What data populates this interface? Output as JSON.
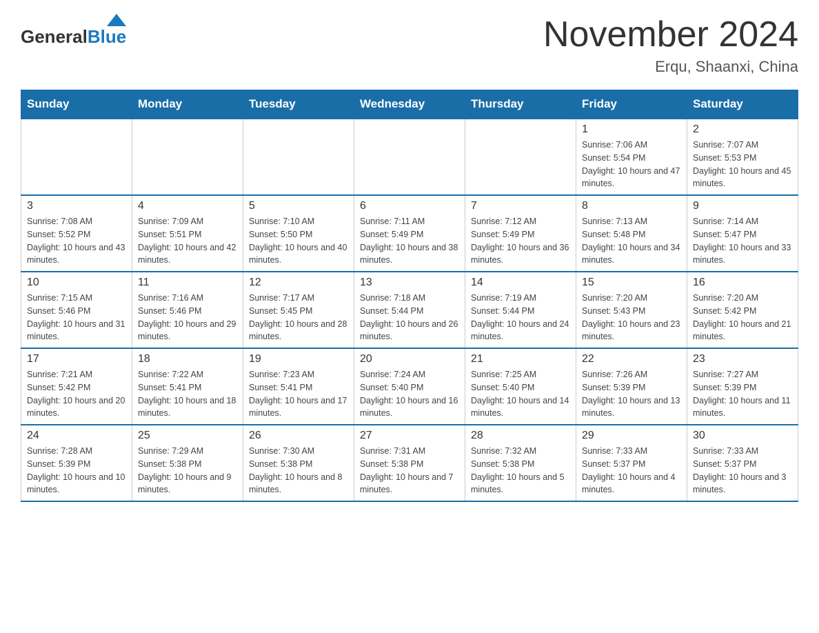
{
  "header": {
    "logo_general": "General",
    "logo_blue": "Blue",
    "month_title": "November 2024",
    "location": "Erqu, Shaanxi, China"
  },
  "weekdays": [
    "Sunday",
    "Monday",
    "Tuesday",
    "Wednesday",
    "Thursday",
    "Friday",
    "Saturday"
  ],
  "weeks": [
    [
      {
        "day": "",
        "sunrise": "",
        "sunset": "",
        "daylight": ""
      },
      {
        "day": "",
        "sunrise": "",
        "sunset": "",
        "daylight": ""
      },
      {
        "day": "",
        "sunrise": "",
        "sunset": "",
        "daylight": ""
      },
      {
        "day": "",
        "sunrise": "",
        "sunset": "",
        "daylight": ""
      },
      {
        "day": "",
        "sunrise": "",
        "sunset": "",
        "daylight": ""
      },
      {
        "day": "1",
        "sunrise": "Sunrise: 7:06 AM",
        "sunset": "Sunset: 5:54 PM",
        "daylight": "Daylight: 10 hours and 47 minutes."
      },
      {
        "day": "2",
        "sunrise": "Sunrise: 7:07 AM",
        "sunset": "Sunset: 5:53 PM",
        "daylight": "Daylight: 10 hours and 45 minutes."
      }
    ],
    [
      {
        "day": "3",
        "sunrise": "Sunrise: 7:08 AM",
        "sunset": "Sunset: 5:52 PM",
        "daylight": "Daylight: 10 hours and 43 minutes."
      },
      {
        "day": "4",
        "sunrise": "Sunrise: 7:09 AM",
        "sunset": "Sunset: 5:51 PM",
        "daylight": "Daylight: 10 hours and 42 minutes."
      },
      {
        "day": "5",
        "sunrise": "Sunrise: 7:10 AM",
        "sunset": "Sunset: 5:50 PM",
        "daylight": "Daylight: 10 hours and 40 minutes."
      },
      {
        "day": "6",
        "sunrise": "Sunrise: 7:11 AM",
        "sunset": "Sunset: 5:49 PM",
        "daylight": "Daylight: 10 hours and 38 minutes."
      },
      {
        "day": "7",
        "sunrise": "Sunrise: 7:12 AM",
        "sunset": "Sunset: 5:49 PM",
        "daylight": "Daylight: 10 hours and 36 minutes."
      },
      {
        "day": "8",
        "sunrise": "Sunrise: 7:13 AM",
        "sunset": "Sunset: 5:48 PM",
        "daylight": "Daylight: 10 hours and 34 minutes."
      },
      {
        "day": "9",
        "sunrise": "Sunrise: 7:14 AM",
        "sunset": "Sunset: 5:47 PM",
        "daylight": "Daylight: 10 hours and 33 minutes."
      }
    ],
    [
      {
        "day": "10",
        "sunrise": "Sunrise: 7:15 AM",
        "sunset": "Sunset: 5:46 PM",
        "daylight": "Daylight: 10 hours and 31 minutes."
      },
      {
        "day": "11",
        "sunrise": "Sunrise: 7:16 AM",
        "sunset": "Sunset: 5:46 PM",
        "daylight": "Daylight: 10 hours and 29 minutes."
      },
      {
        "day": "12",
        "sunrise": "Sunrise: 7:17 AM",
        "sunset": "Sunset: 5:45 PM",
        "daylight": "Daylight: 10 hours and 28 minutes."
      },
      {
        "day": "13",
        "sunrise": "Sunrise: 7:18 AM",
        "sunset": "Sunset: 5:44 PM",
        "daylight": "Daylight: 10 hours and 26 minutes."
      },
      {
        "day": "14",
        "sunrise": "Sunrise: 7:19 AM",
        "sunset": "Sunset: 5:44 PM",
        "daylight": "Daylight: 10 hours and 24 minutes."
      },
      {
        "day": "15",
        "sunrise": "Sunrise: 7:20 AM",
        "sunset": "Sunset: 5:43 PM",
        "daylight": "Daylight: 10 hours and 23 minutes."
      },
      {
        "day": "16",
        "sunrise": "Sunrise: 7:20 AM",
        "sunset": "Sunset: 5:42 PM",
        "daylight": "Daylight: 10 hours and 21 minutes."
      }
    ],
    [
      {
        "day": "17",
        "sunrise": "Sunrise: 7:21 AM",
        "sunset": "Sunset: 5:42 PM",
        "daylight": "Daylight: 10 hours and 20 minutes."
      },
      {
        "day": "18",
        "sunrise": "Sunrise: 7:22 AM",
        "sunset": "Sunset: 5:41 PM",
        "daylight": "Daylight: 10 hours and 18 minutes."
      },
      {
        "day": "19",
        "sunrise": "Sunrise: 7:23 AM",
        "sunset": "Sunset: 5:41 PM",
        "daylight": "Daylight: 10 hours and 17 minutes."
      },
      {
        "day": "20",
        "sunrise": "Sunrise: 7:24 AM",
        "sunset": "Sunset: 5:40 PM",
        "daylight": "Daylight: 10 hours and 16 minutes."
      },
      {
        "day": "21",
        "sunrise": "Sunrise: 7:25 AM",
        "sunset": "Sunset: 5:40 PM",
        "daylight": "Daylight: 10 hours and 14 minutes."
      },
      {
        "day": "22",
        "sunrise": "Sunrise: 7:26 AM",
        "sunset": "Sunset: 5:39 PM",
        "daylight": "Daylight: 10 hours and 13 minutes."
      },
      {
        "day": "23",
        "sunrise": "Sunrise: 7:27 AM",
        "sunset": "Sunset: 5:39 PM",
        "daylight": "Daylight: 10 hours and 11 minutes."
      }
    ],
    [
      {
        "day": "24",
        "sunrise": "Sunrise: 7:28 AM",
        "sunset": "Sunset: 5:39 PM",
        "daylight": "Daylight: 10 hours and 10 minutes."
      },
      {
        "day": "25",
        "sunrise": "Sunrise: 7:29 AM",
        "sunset": "Sunset: 5:38 PM",
        "daylight": "Daylight: 10 hours and 9 minutes."
      },
      {
        "day": "26",
        "sunrise": "Sunrise: 7:30 AM",
        "sunset": "Sunset: 5:38 PM",
        "daylight": "Daylight: 10 hours and 8 minutes."
      },
      {
        "day": "27",
        "sunrise": "Sunrise: 7:31 AM",
        "sunset": "Sunset: 5:38 PM",
        "daylight": "Daylight: 10 hours and 7 minutes."
      },
      {
        "day": "28",
        "sunrise": "Sunrise: 7:32 AM",
        "sunset": "Sunset: 5:38 PM",
        "daylight": "Daylight: 10 hours and 5 minutes."
      },
      {
        "day": "29",
        "sunrise": "Sunrise: 7:33 AM",
        "sunset": "Sunset: 5:37 PM",
        "daylight": "Daylight: 10 hours and 4 minutes."
      },
      {
        "day": "30",
        "sunrise": "Sunrise: 7:33 AM",
        "sunset": "Sunset: 5:37 PM",
        "daylight": "Daylight: 10 hours and 3 minutes."
      }
    ]
  ]
}
